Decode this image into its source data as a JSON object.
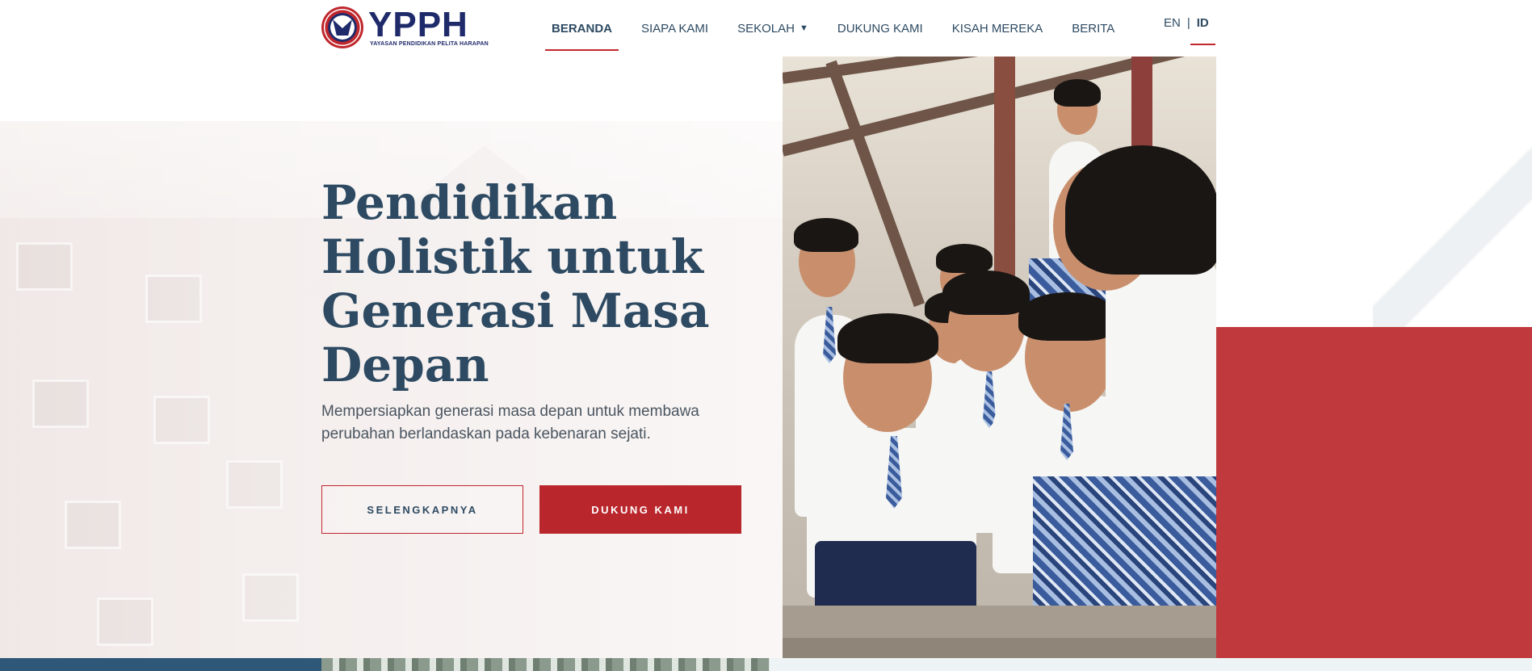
{
  "brand": {
    "name": "YPPH",
    "tagline": "YAYASAN PENDIDIKAN PELITA HARAPAN",
    "colors": {
      "navy": "#1f2a6b",
      "primary_text": "#2d4a62",
      "accent_red": "#c0272d"
    }
  },
  "nav": {
    "items": [
      {
        "label": "BERANDA",
        "active": true
      },
      {
        "label": "SIAPA KAMI",
        "active": false
      },
      {
        "label": "SEKOLAH",
        "active": false,
        "has_dropdown": true
      },
      {
        "label": "DUKUNG KAMI",
        "active": false
      },
      {
        "label": "KISAH MEREKA",
        "active": false
      },
      {
        "label": "BERITA",
        "active": false
      }
    ],
    "dropdown_icon": "chevron-down-icon"
  },
  "language": {
    "en": "EN",
    "separator": "|",
    "id": "ID",
    "selected": "ID"
  },
  "hero": {
    "title": "Pendidikan Holistik untuk Generasi Masa Depan",
    "subtitle": "Mempersiapkan generasi masa depan untuk membawa perubahan berlandaskan pada kebenaran sejati.",
    "buttons": {
      "more": "SELENGKAPNYA",
      "support": "DUKUNG KAMI"
    }
  }
}
